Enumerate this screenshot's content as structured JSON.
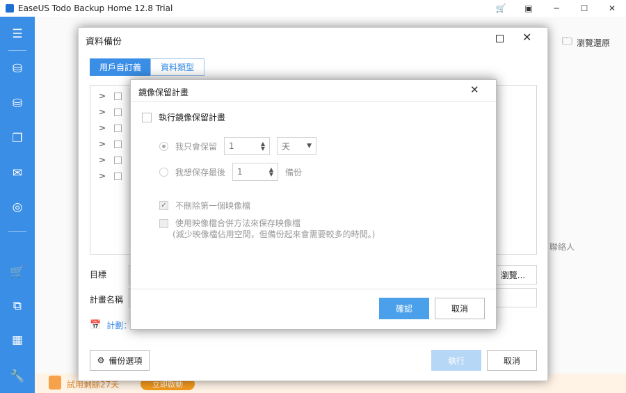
{
  "app": {
    "title": "EaseUS Todo Backup Home 12.8 Trial"
  },
  "titlebar": {
    "cart_icon": "cart-icon",
    "minimize": "─",
    "maximize": "☐",
    "close": "✕",
    "menu": "▣"
  },
  "sidebar": {
    "items": [
      {
        "name": "menu",
        "glyph": "☰"
      },
      {
        "name": "disk-backup",
        "glyph": "⛁"
      },
      {
        "name": "system-backup",
        "glyph": "⛁"
      },
      {
        "name": "file-backup",
        "glyph": "❐"
      },
      {
        "name": "mail-backup",
        "glyph": "✉"
      },
      {
        "name": "smart-backup",
        "glyph": "◎"
      },
      {
        "name": "cart",
        "glyph": "🛒"
      },
      {
        "name": "clone",
        "glyph": "⧉"
      },
      {
        "name": "tools",
        "glyph": "▦"
      },
      {
        "name": "settings",
        "glyph": "🔧"
      }
    ],
    "accent": "#3a8ee6"
  },
  "main": {
    "browse_restore": "瀏覽還原",
    "contacts_partial": "聯絡人",
    "trial_text": "試用剩餘27天",
    "activate": "立即啟動"
  },
  "backup_dialog": {
    "title": "資料備份",
    "tabs": [
      "用戶自訂義",
      "資料類型"
    ],
    "tree_rows": 6,
    "target_label": "目標",
    "browse_button": "瀏覽...",
    "plan_name_label": "計畫名稱",
    "schedule_label": "計劃：",
    "backup_options": "備份選項",
    "run_button": "執行",
    "cancel_button": "取消"
  },
  "retain_dialog": {
    "title": "鏡像保留計畫",
    "enable_label": "執行鏡像保留計畫",
    "keep_only_label": "我只會保留",
    "keep_only_value": "1",
    "keep_unit": "天",
    "keep_last_label": "我想保存最後",
    "keep_last_value": "1",
    "keep_last_unit": "備份",
    "no_delete_first_label": "不刪除第一個映像檔",
    "merge_label": "使用映像檔合併方法來保存映像檔",
    "merge_note": "(減少映像檔佔用空間，但備份起來會需要較多的時間。)",
    "ok_button": "確認",
    "cancel_button": "取消"
  }
}
